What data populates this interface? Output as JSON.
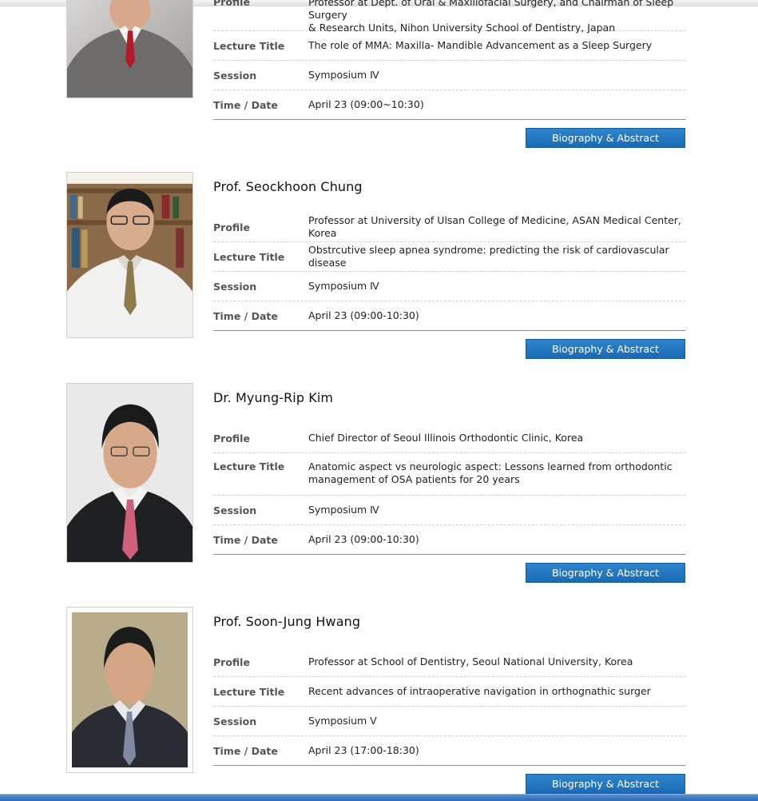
{
  "labels": {
    "profile": "Profile",
    "lecture_title": "Lecture Title",
    "session": "Session",
    "time_date": "Time / Date",
    "button": "Biography & Abstract"
  },
  "speakers": [
    {
      "name": "",
      "profile_line1": "Professor at Dept. of Oral & Maxillofacial Surgery, and Chairman of Sleep Surgery",
      "profile_line2": "& Research Units, Nihon University School of Dentistry, Japan",
      "lecture": "The role of MMA: Maxilla- Mandible Advancement as a Sleep Surgery",
      "session": "Symposium Ⅳ",
      "time": "April 23 (09:00~10:30)"
    },
    {
      "name": "Prof. Seockhoon Chung",
      "profile": "Professor at University of Ulsan College of Medicine, ASAN Medical Center, Korea",
      "lecture": "Obstrcutive sleep apnea syndrome: predicting the risk of cardiovascular disease",
      "session": "Symposium Ⅳ",
      "time": "April 23 (09:00-10:30)"
    },
    {
      "name": "Dr. Myung-Rip Kim",
      "profile": "Chief Director of Seoul Illinois Orthodontic Clinic, Korea",
      "lecture": "Anatomic aspect vs neurologic aspect: Lessons learned from orthodontic management of OSA patients for 20 years",
      "session": "Symposium Ⅳ",
      "time": "April 23 (09:00-10:30)"
    },
    {
      "name": "Prof. Soon-Jung Hwang",
      "profile": "Professor at School of Dentistry, Seoul National University, Korea",
      "lecture": "Recent advances of intraoperative navigation in orthognathic surger",
      "session": "Symposium Ⅴ",
      "time": "April 23 (17:00-18:30)"
    }
  ]
}
